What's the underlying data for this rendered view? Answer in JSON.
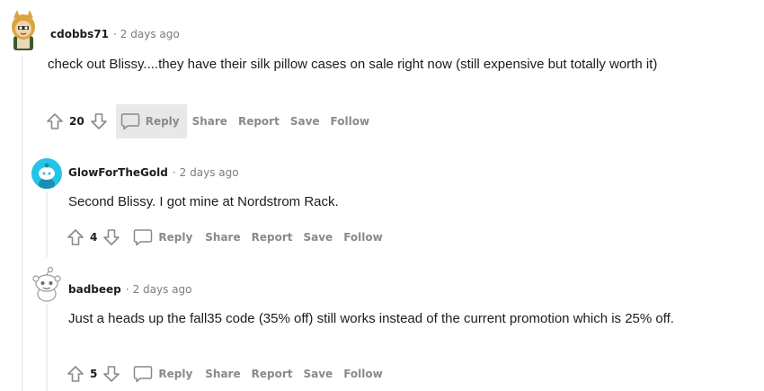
{
  "comments": [
    {
      "username": "cdobbs71",
      "age": "2 days ago",
      "body": "check out Blissy....they have their silk pillow cases on sale right now (still expensive but totally worth it)",
      "score": "20",
      "reply_label": "Reply",
      "share_label": "Share",
      "report_label": "Report",
      "save_label": "Save",
      "follow_label": "Follow"
    },
    {
      "username": "GlowForTheGold",
      "age": "2 days ago",
      "body": "Second Blissy. I got mine at Nordstrom Rack.",
      "score": "4",
      "reply_label": "Reply",
      "share_label": "Share",
      "report_label": "Report",
      "save_label": "Save",
      "follow_label": "Follow"
    },
    {
      "username": "badbeep",
      "age": "2 days ago",
      "body": "Just a heads up the fall35 code (35% off) still works instead of the current promotion which is 25% off.",
      "score": "5",
      "reply_label": "Reply",
      "share_label": "Share",
      "report_label": "Report",
      "save_label": "Save",
      "follow_label": "Follow"
    }
  ],
  "separator": "·",
  "colors": {
    "text": "#1c1c1c",
    "meta": "#7c7c7c",
    "action": "#878a8c",
    "thread_line": "#edeff1",
    "hover_bg": "#e8e8e8",
    "avatar_teal": "#24c4e6"
  }
}
